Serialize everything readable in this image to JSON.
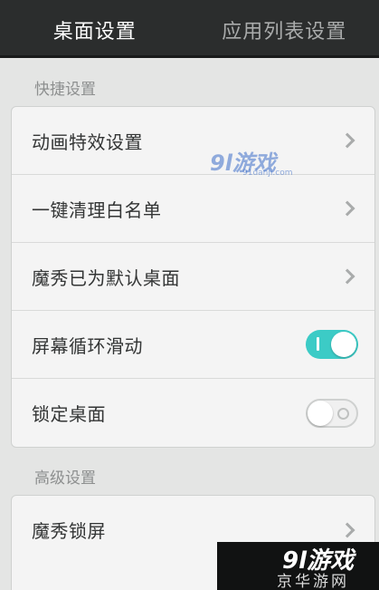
{
  "tabs": [
    {
      "label": "桌面设置",
      "active": true
    },
    {
      "label": "应用列表设置",
      "active": false
    }
  ],
  "sections": [
    {
      "label": "快捷设置",
      "items": [
        {
          "label": "动画特效设置",
          "control": "chevron"
        },
        {
          "label": "一键清理白名单",
          "control": "chevron"
        },
        {
          "label": "魔秀已为默认桌面",
          "control": "chevron"
        },
        {
          "label": "屏幕循环滑动",
          "control": "toggle",
          "state": "on"
        },
        {
          "label": "锁定桌面",
          "control": "toggle",
          "state": "off"
        }
      ]
    },
    {
      "label": "高级设置",
      "items": [
        {
          "label": "魔秀锁屏",
          "control": "chevron"
        }
      ]
    }
  ],
  "watermark": {
    "logo": "9l游戏",
    "site": "91danji.com"
  },
  "corner_watermark": {
    "logo": "9l游戏",
    "text": "京华游网"
  },
  "colors": {
    "accent": "#3ccbc6",
    "tabbar": "#2b2d2d",
    "background": "#e4e5e4"
  }
}
